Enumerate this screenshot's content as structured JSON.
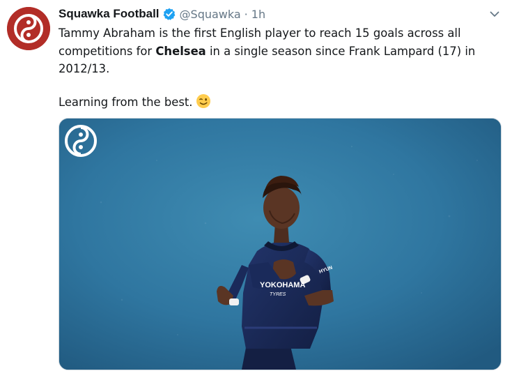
{
  "tweet": {
    "display_name": "Squawka Football",
    "handle": "@Squawka",
    "separator": "·",
    "time": "1h",
    "text_part1": "Tammy Abraham is the first English player to reach 15 goals across all competitions for ",
    "text_bold": "Chelsea",
    "text_part2": " in a single season since Frank Lampard (17) in 2012/13.",
    "text_line2": "Learning from the best.",
    "emoji": "winking-face"
  },
  "media": {
    "kit_sponsor": "YOKOHAMA",
    "kit_sponsor_line2": "TYRES",
    "sleeve_text": "HYUN"
  },
  "colors": {
    "brand_red": "#b22d27",
    "verified_blue": "#1da1f2",
    "muted_text": "#657786",
    "photo_blue": "#2f77a0",
    "kit_navy": "#1a2a55"
  },
  "icons": {
    "avatar": "squawka-logo-icon",
    "verified": "verified-badge-icon",
    "caret": "chevron-down-icon",
    "emoji": "winking-face-emoji-icon"
  }
}
